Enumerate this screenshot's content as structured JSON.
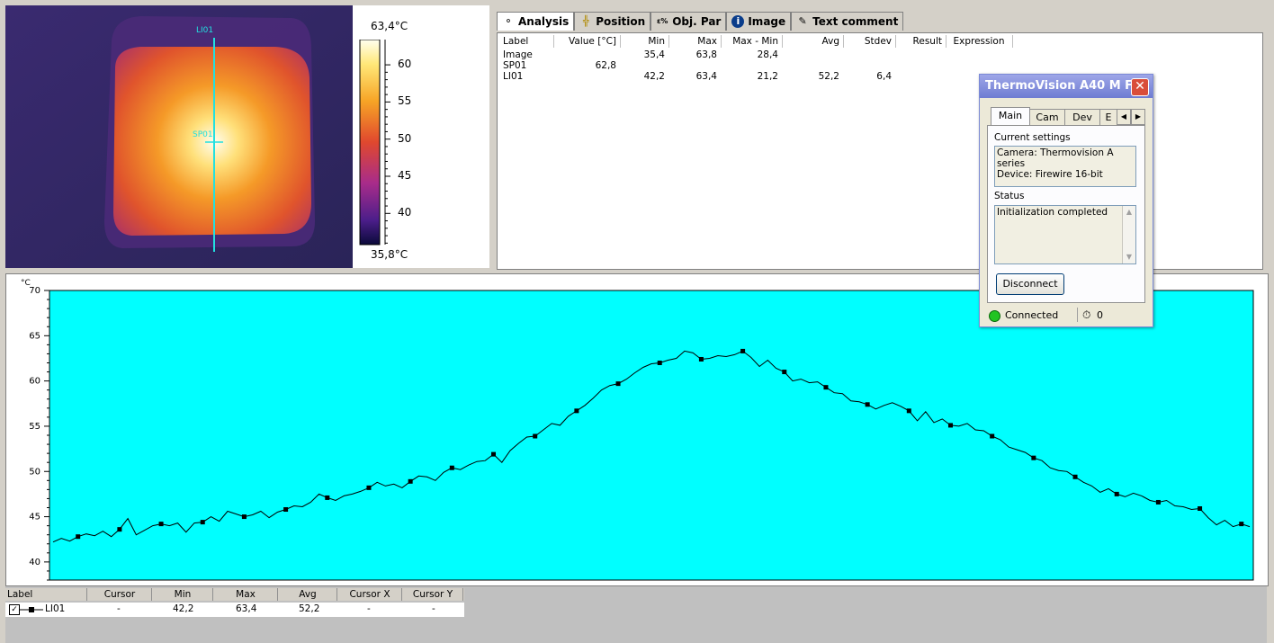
{
  "thermal": {
    "line_label": "LI01",
    "spot_label": "SP01",
    "scale_max": "63,4°C",
    "scale_min": "35,8°C",
    "scale_ticks": [
      "60",
      "55",
      "50",
      "45",
      "40"
    ],
    "colors": {
      "hot": "#fffbe8",
      "warm": "#f5a523",
      "mid": "#e0522a",
      "cool": "#8b2a8c",
      "cold": "#2a2458",
      "line": "#22e0e0"
    }
  },
  "analysis": {
    "tabs": [
      {
        "label": "Analysis",
        "icon": "analysis-icon"
      },
      {
        "label": "Position",
        "icon": "position-icon"
      },
      {
        "label": "Obj. Par",
        "icon": "object-parameters-icon"
      },
      {
        "label": "Image",
        "icon": "info-icon"
      },
      {
        "label": "Text comment",
        "icon": "text-comment-icon"
      }
    ],
    "columns": [
      "Label",
      "Value [°C]",
      "Min",
      "Max",
      "Max - Min",
      "Avg",
      "Stdev",
      "Result",
      "Expression"
    ],
    "rows": [
      {
        "label": "Image",
        "value": "",
        "min": "35,4",
        "max": "63,8",
        "maxmin": "28,4",
        "avg": "",
        "stdev": ""
      },
      {
        "label": "SP01",
        "value": "62,8",
        "min": "",
        "max": "",
        "maxmin": "",
        "avg": "",
        "stdev": ""
      },
      {
        "label": "LI01",
        "value": "",
        "min": "42,2",
        "max": "63,4",
        "maxmin": "21,2",
        "avg": "52,2",
        "stdev": "6,4"
      }
    ]
  },
  "window": {
    "title": "ThermoVision A40 M F...",
    "tabs": [
      "Main",
      "Cam",
      "Dev",
      "E"
    ],
    "current_settings_label": "Current settings",
    "camera_line": "Camera: Thermovision A series",
    "device_line": "Device: Firewire 16-bit",
    "status_label": "Status",
    "status_text": "Initialization completed",
    "disconnect_label": "Disconnect",
    "connection_status": "Connected",
    "counter": "0"
  },
  "chart_data": {
    "type": "line",
    "ylabel": "°C",
    "ylim": [
      38,
      70
    ],
    "yticks": [
      "70",
      "65",
      "60",
      "55",
      "50",
      "45",
      "40"
    ],
    "grid": false,
    "background": "#00ffff",
    "series": [
      {
        "values": [
          42.2,
          42.6,
          42.3,
          42.8,
          43.1,
          42.9,
          43.4,
          42.8,
          43.6,
          44.8,
          43.0,
          43.5,
          44.0,
          44.2,
          44.0,
          44.3,
          43.3,
          44.3,
          44.4,
          45.0,
          44.5,
          45.6,
          45.3,
          45.0,
          45.2,
          45.6,
          44.9,
          45.5,
          45.8,
          46.2,
          46.1,
          46.6,
          47.5,
          47.1,
          46.8,
          47.3,
          47.5,
          47.8,
          48.2,
          48.8,
          48.4,
          48.6,
          48.2,
          48.9,
          49.5,
          49.4,
          49.0,
          49.9,
          50.4,
          50.2,
          50.7,
          51.1,
          51.2,
          51.9,
          51.0,
          52.3,
          53.1,
          53.8,
          53.9,
          54.6,
          55.3,
          55.1,
          56.1,
          56.7,
          57.3,
          58.1,
          59.0,
          59.5,
          59.7,
          60.2,
          60.9,
          61.5,
          61.9,
          62.0,
          62.3,
          62.5,
          63.3,
          63.1,
          62.4,
          62.5,
          62.8,
          62.7,
          62.9,
          63.3,
          62.6,
          61.6,
          62.3,
          61.4,
          61.0,
          60.0,
          60.2,
          59.8,
          59.9,
          59.3,
          58.7,
          58.6,
          57.8,
          57.7,
          57.4,
          56.9,
          57.3,
          57.6,
          57.2,
          56.7,
          55.6,
          56.6,
          55.4,
          55.8,
          55.1,
          55.0,
          55.3,
          54.6,
          54.5,
          53.9,
          53.5,
          52.7,
          52.4,
          52.1,
          51.5,
          51.2,
          50.4,
          50.1,
          50.0,
          49.4,
          48.8,
          48.4,
          47.7,
          48.1,
          47.5,
          47.2,
          47.6,
          47.3,
          46.8,
          46.6,
          46.8,
          46.2,
          46.1,
          45.8,
          45.9,
          44.9,
          44.1,
          44.6,
          43.9,
          44.2,
          43.9
        ],
        "marker_every": 5
      }
    ]
  },
  "legend_table": {
    "columns": [
      "Label",
      "Cursor",
      "Min",
      "Max",
      "Avg",
      "Cursor X",
      "Cursor Y"
    ],
    "row": {
      "label": "LI01",
      "cursor": "-",
      "min": "42,2",
      "max": "63,4",
      "avg": "52,2",
      "cursor_x": "-",
      "cursor_y": "-"
    }
  }
}
